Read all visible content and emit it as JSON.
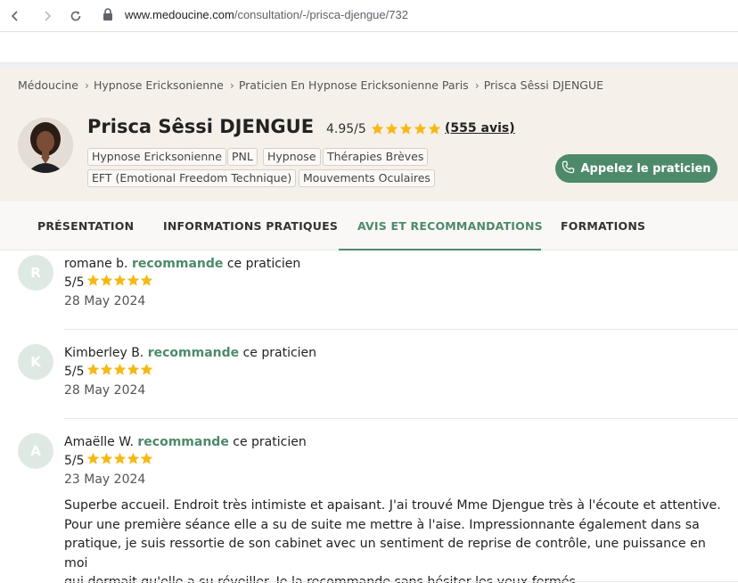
{
  "browser": {
    "url_host": "www.medoucine.com",
    "url_path": "/consultation/-/prisca-djengue/732"
  },
  "breadcrumb": [
    "Médoucine",
    "Hypnose Ericksonienne",
    "Praticien En Hypnose Ericksonienne Paris",
    "Prisca Sêssi DJENGUE"
  ],
  "practitioner": {
    "name": "Prisca Sêssi DJENGUE",
    "rating": "4.95/5",
    "stars": 5,
    "reviews_link": "(555 avis)",
    "tags_row1": [
      "Hypnose Ericksonienne",
      "PNL",
      "Hypnose",
      "Thérapies Brèves"
    ],
    "tags_row2": [
      "EFT (Emotional Freedom Technique)",
      "Mouvements Oculaires"
    ],
    "call_button": "Appelez le praticien"
  },
  "tabs": [
    {
      "label": "PRÉSENTATION"
    },
    {
      "label": "INFORMATIONS PRATIQUES"
    },
    {
      "label": "AVIS ET RECOMMANDATIONS",
      "active": true
    },
    {
      "label": "FORMATIONS"
    }
  ],
  "reviews": [
    {
      "initial": "R",
      "author": "romane b.",
      "recommend": "recommande",
      "suffix": "ce praticien",
      "score": "5/5",
      "stars": 5,
      "date": "28 May 2024"
    },
    {
      "initial": "K",
      "author": "Kimberley B.",
      "recommend": "recommande",
      "suffix": "ce praticien",
      "score": "5/5",
      "stars": 5,
      "date": "28 May 2024"
    },
    {
      "initial": "A",
      "author": "Amaëlle W.",
      "recommend": "recommande",
      "suffix": "ce praticien",
      "score": "5/5",
      "stars": 5,
      "date": "23 May 2024",
      "text_lines": [
        "Superbe accueil. Endroit très intimiste et apaisant. J'ai trouvé Mme Djengue très à l'écoute et attentive.",
        "Pour une première séance elle a su de suite me mettre à l'aise. Impressionnante également dans sa",
        "pratique, je suis ressortie de son cabinet avec un sentiment de reprise de contrôle, une puissance en moi",
        "qui dormait qu'elle a su réveiller. Je la recommande sans hésiter les yeux fermés."
      ]
    }
  ],
  "colors": {
    "accent": "#4d8a6a",
    "star": "#f5b917",
    "header_bg": "#f5f0ea"
  }
}
